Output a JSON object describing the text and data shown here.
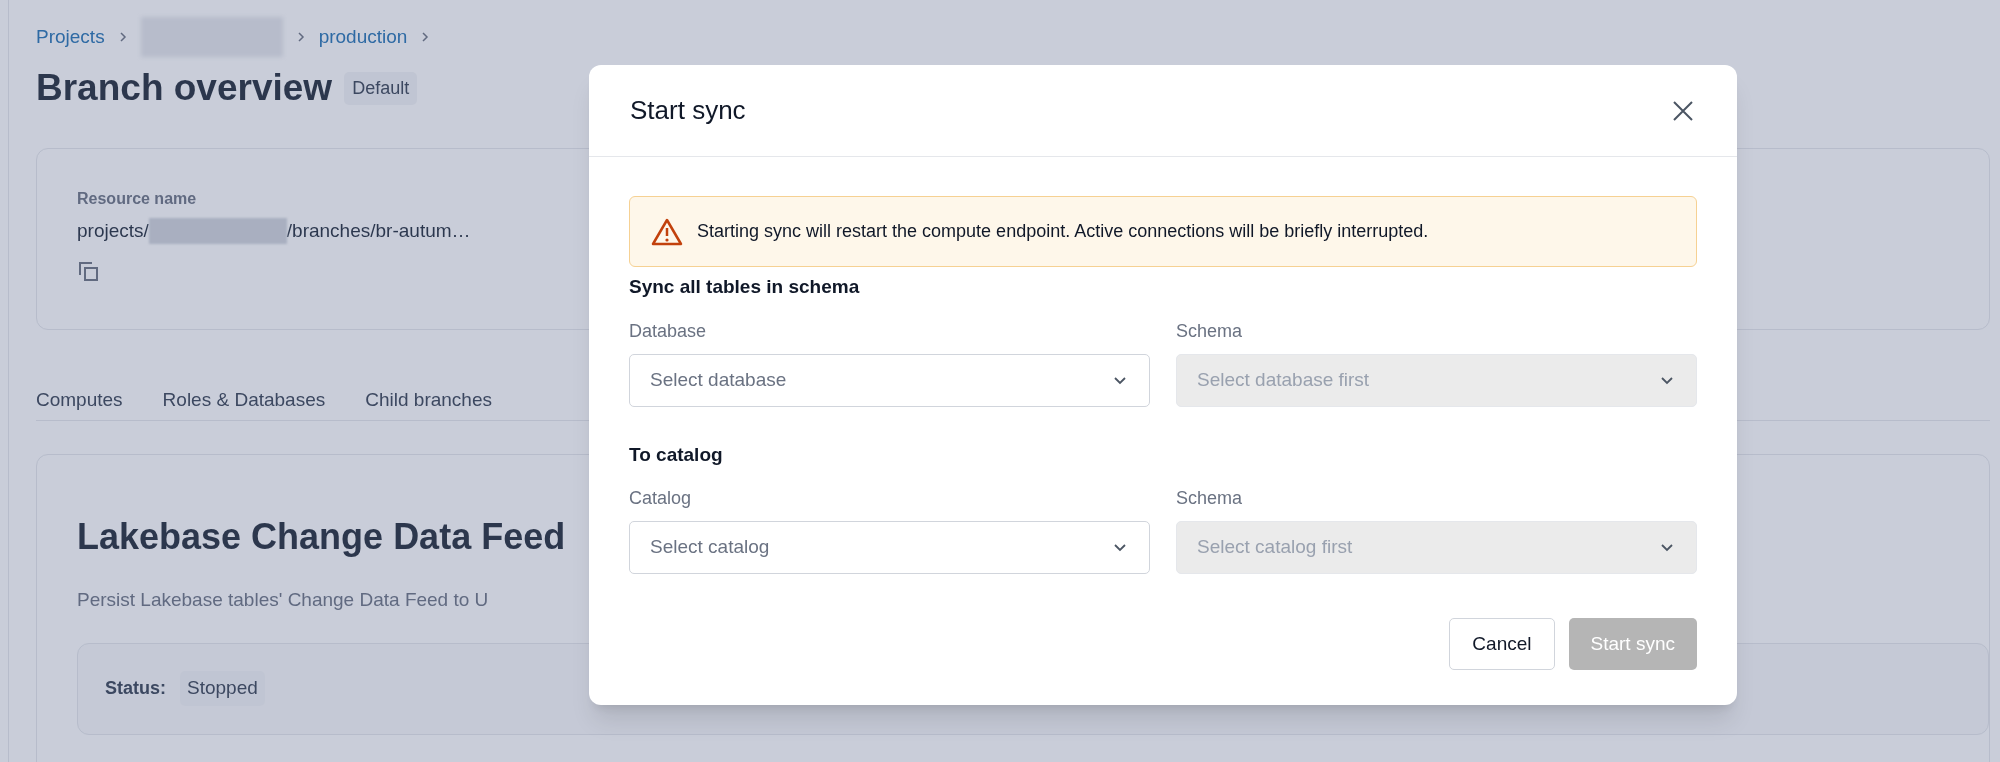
{
  "breadcrumbs": [
    {
      "kind": "link",
      "label": "Projects"
    },
    {
      "kind": "redacted"
    },
    {
      "kind": "link",
      "label": "production"
    }
  ],
  "page_title": "Branch overview",
  "branch_badge": "Default",
  "resource": {
    "label": "Resource name",
    "value_start": "projects/",
    "value_end": "/branches/br-autum…"
  },
  "tabs": [
    {
      "label": "Computes"
    },
    {
      "label": "Roles & Databases"
    },
    {
      "label": "Child branches"
    }
  ],
  "feed": {
    "title": "Lakebase Change Data Feed",
    "description": "Persist Lakebase tables' Change Data Feed to U",
    "status_label": "Status:",
    "status": "Stopped"
  },
  "dialog": {
    "title": "Start sync",
    "alert": {
      "kind": "warning",
      "text": "Starting sync will restart the compute endpoint. Active connections will be briefly interrupted."
    },
    "sections": [
      {
        "heading": "Sync all tables in schema",
        "fields": [
          {
            "label": "Database",
            "placeholder": "Select database",
            "disabled": false
          },
          {
            "label": "Schema",
            "placeholder": "Select database first",
            "disabled": true
          }
        ]
      },
      {
        "heading": "To catalog",
        "fields": [
          {
            "label": "Catalog",
            "placeholder": "Select catalog",
            "disabled": false
          },
          {
            "label": "Schema",
            "placeholder": "Select catalog first",
            "disabled": true
          }
        ]
      }
    ],
    "buttons": [
      {
        "label": "Cancel",
        "disabled": false
      },
      {
        "label": "Start sync",
        "disabled": true
      }
    ]
  }
}
